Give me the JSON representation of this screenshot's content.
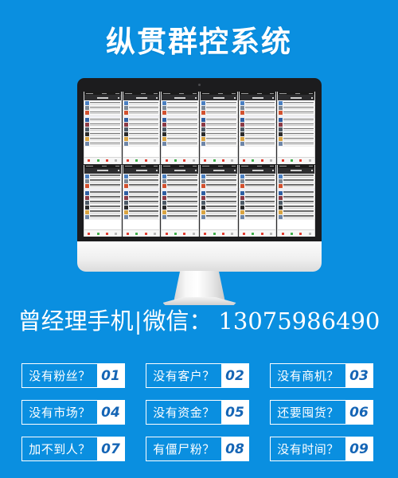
{
  "theme": {
    "background_color": "#0a8fe0",
    "text_color": "#ffffff",
    "number_color": "#1565b5",
    "bezel_color": "#1c1c1e"
  },
  "header": {
    "title": "纵贯群控系统"
  },
  "monitor": {
    "device_name": "desktop-monitor",
    "screen": {
      "grid_columns": 6,
      "grid_rows": 2,
      "panel_name": "wechat-phone-screen",
      "panels": [
        {
          "id": "phone-1"
        },
        {
          "id": "phone-2"
        },
        {
          "id": "phone-3"
        },
        {
          "id": "phone-4"
        },
        {
          "id": "phone-5"
        },
        {
          "id": "phone-6"
        },
        {
          "id": "phone-7"
        },
        {
          "id": "phone-8"
        },
        {
          "id": "phone-9"
        },
        {
          "id": "phone-10"
        },
        {
          "id": "phone-11"
        },
        {
          "id": "phone-12"
        }
      ],
      "panel_rows": [
        {
          "avatar_color": "#4a7fc1",
          "has_sep_after": false
        },
        {
          "avatar_color": "#7b8794",
          "has_sep_after": false
        },
        {
          "avatar_color": "#d2512f",
          "has_sep_after": true
        },
        {
          "avatar_color": "#2e5fa3",
          "has_sep_after": false
        },
        {
          "avatar_color": "#8c3b46",
          "has_sep_after": false
        },
        {
          "avatar_color": "#4d5a66",
          "has_sep_after": false
        },
        {
          "avatar_color": "#2b2b2b",
          "has_sep_after": false
        },
        {
          "avatar_color": "#d9a441",
          "has_sep_after": false
        },
        {
          "avatar_color": "#6e86a8",
          "has_sep_after": false
        }
      ],
      "tab_colors": [
        "#e03b30",
        "#3fae4a",
        "#e03b30",
        "#b9b9b9"
      ]
    }
  },
  "contact": {
    "label": "曾经理手机",
    "divider": "|",
    "channel": "微信：",
    "number": "13075986490"
  },
  "tags": [
    {
      "label": "没有粉丝？",
      "number": "01"
    },
    {
      "label": "没有客户？",
      "number": "02"
    },
    {
      "label": "没有商机？",
      "number": "03"
    },
    {
      "label": "没有市场？",
      "number": "04"
    },
    {
      "label": "没有资金？",
      "number": "05"
    },
    {
      "label": "还要囤货？",
      "number": "06"
    },
    {
      "label": "加不到人？",
      "number": "07"
    },
    {
      "label": "有僵尸粉？",
      "number": "08"
    },
    {
      "label": "没有时间？",
      "number": "09"
    }
  ]
}
